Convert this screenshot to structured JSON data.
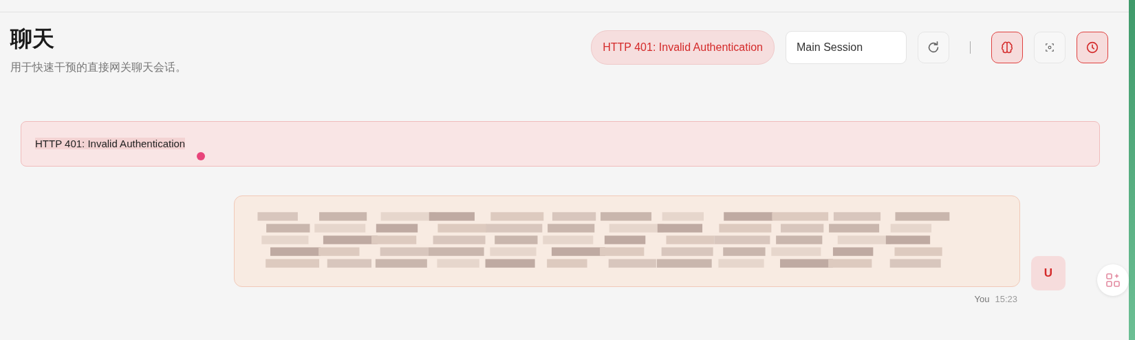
{
  "header": {
    "title": "聊天",
    "subtitle": "用于快速干预的直接网关聊天会话。"
  },
  "toolbar": {
    "error_pill": "HTTP 401: Invalid Authentication",
    "session_field": {
      "value": "Main Session"
    },
    "buttons": [
      {
        "kind": "refresh",
        "active": false
      },
      {
        "kind": "divider"
      },
      {
        "kind": "brain",
        "active": true
      },
      {
        "kind": "focus",
        "active": false
      },
      {
        "kind": "clock",
        "active": true
      }
    ]
  },
  "error_banner": {
    "text": "HTTP 401: Invalid Authentication"
  },
  "messages": [
    {
      "kind": "picture",
      "avatar": "U",
      "sender": "You",
      "time": "15:23"
    }
  ]
}
